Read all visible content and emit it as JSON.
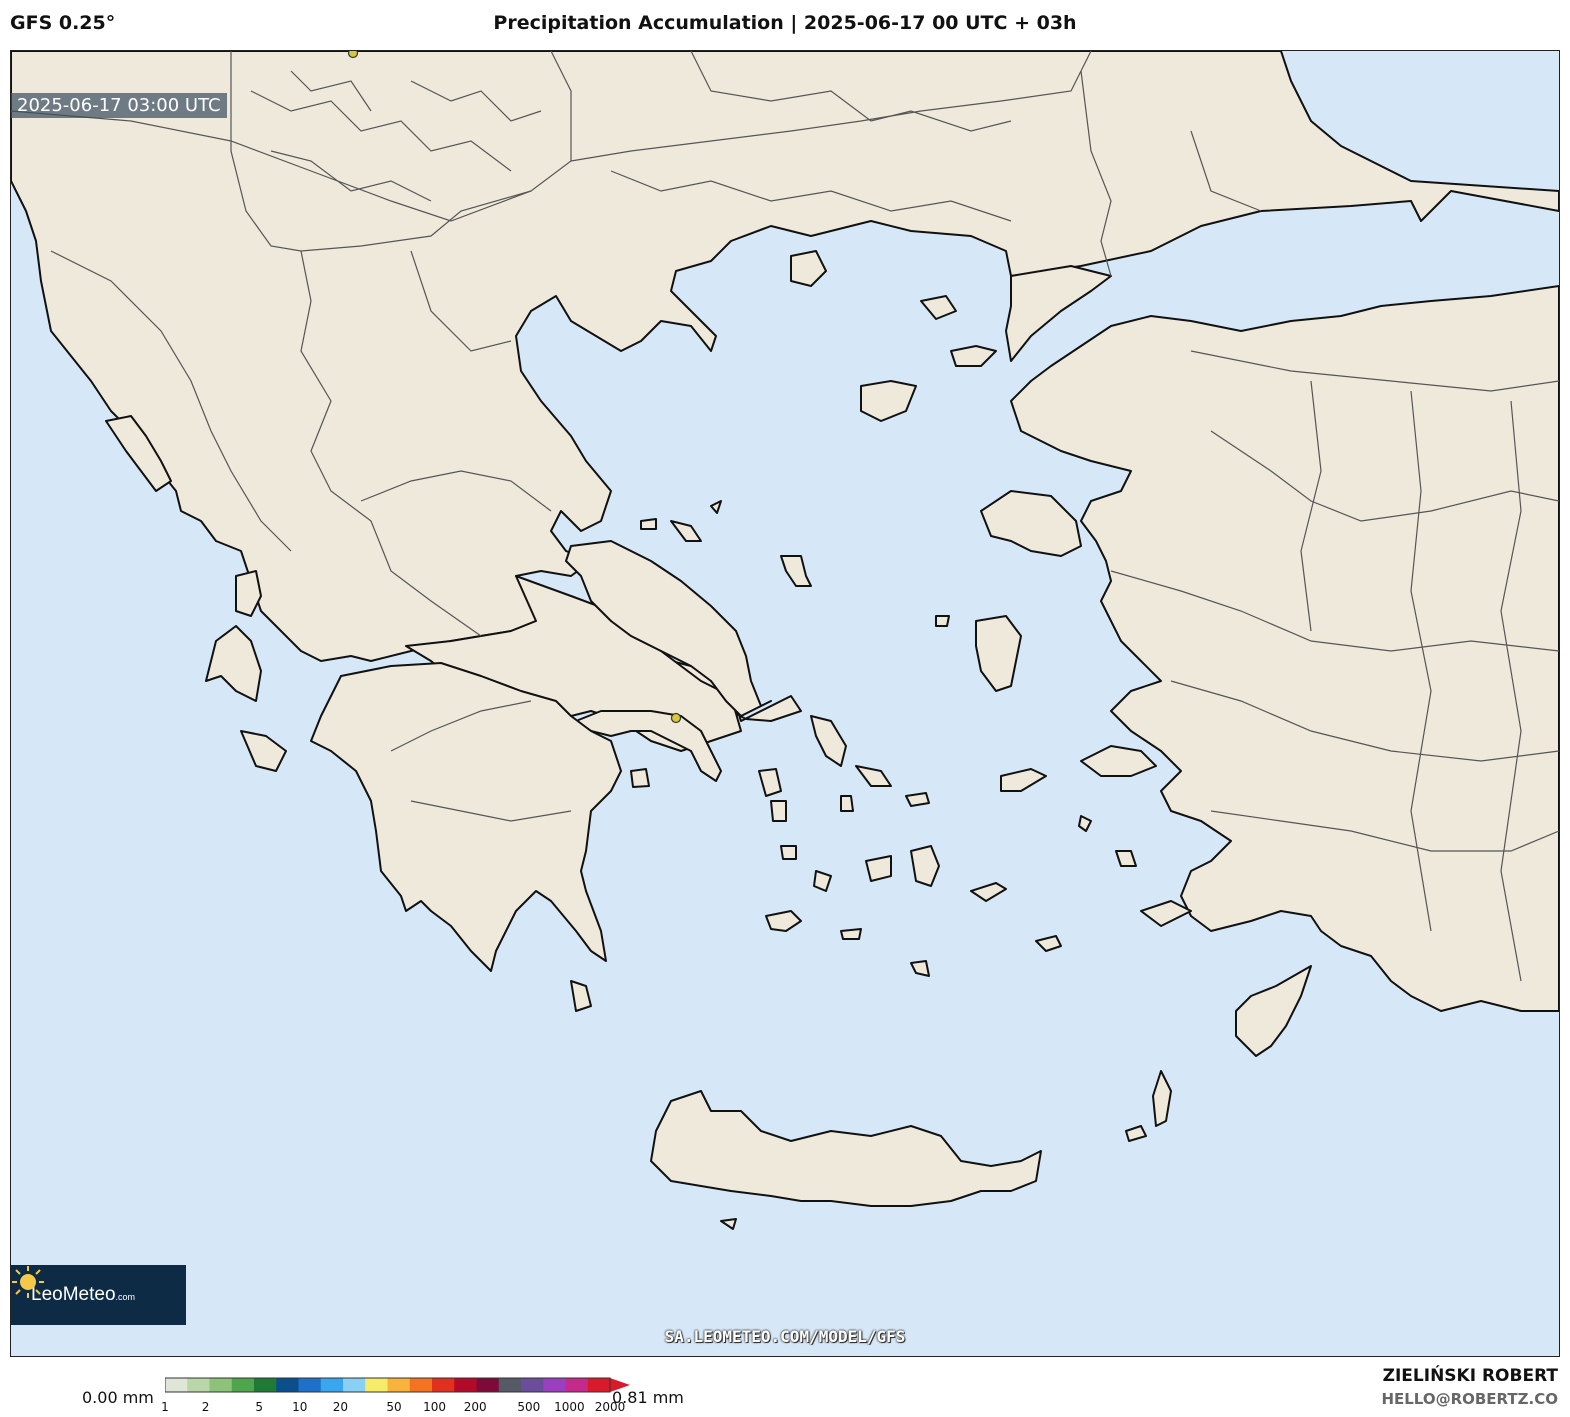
{
  "header": {
    "model": "GFS 0.25°",
    "title": "Precipitation Accumulation | 2025-06-17 00 UTC + 03h"
  },
  "map": {
    "valid_time": "2025-06-17 03:00 UTC",
    "watermark_url": "SA.LEOMETEO.COM/MODEL/GFS",
    "logo": {
      "name": "LeoMeteo",
      "suffix": ".com"
    },
    "colors": {
      "sea": "#d6e8f8",
      "land": "#efe9dc",
      "coast": "#111111",
      "borders": "#555555",
      "city_marker": "#d8c93a"
    }
  },
  "legend": {
    "min_label": "0.00 mm",
    "max_label": "0.81 mm",
    "ticks": [
      "1",
      "2",
      "5",
      "10",
      "20",
      "50",
      "100",
      "200",
      "500",
      "1000",
      "2000"
    ],
    "colors": [
      "#dfe6d8",
      "#b8d6a8",
      "#8cc27a",
      "#4ea54c",
      "#1f7a35",
      "#0a4e8c",
      "#1e70c8",
      "#39a6ee",
      "#8ad0f5",
      "#f7ec6a",
      "#f9b33c",
      "#f27423",
      "#e0301e",
      "#b30a2a",
      "#7d0b3a",
      "#555a66",
      "#6b4d9b",
      "#9a3fbf",
      "#c42a8a",
      "#d81a2a"
    ]
  },
  "credits": {
    "author": "ZIELIŃSKI ROBERT",
    "email": "HELLO@ROBERTZ.CO"
  }
}
